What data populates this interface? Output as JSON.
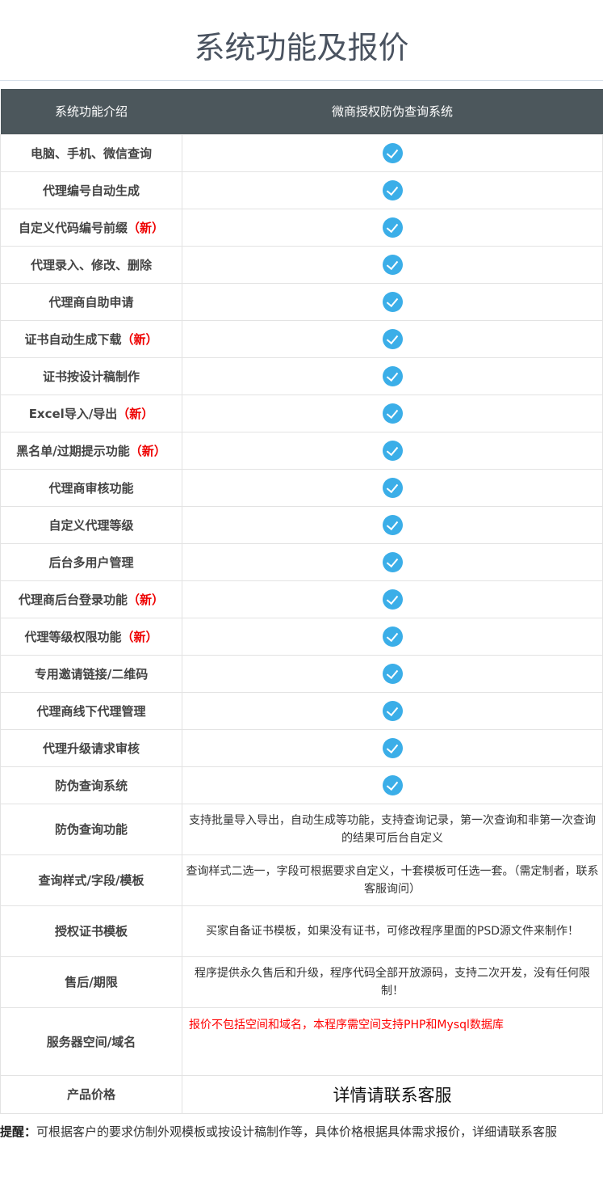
{
  "title": "系统功能及报价",
  "header": {
    "col1": "系统功能介绍",
    "col2": "微商授权防伪查询系统"
  },
  "new_tag": "（新）",
  "features": [
    {
      "label": "电脑、手机、微信查询",
      "new": false
    },
    {
      "label": "代理编号自动生成",
      "new": false
    },
    {
      "label": "自定义代码编号前缀",
      "new": true
    },
    {
      "label": "代理录入、修改、删除",
      "new": false
    },
    {
      "label": "代理商自助申请",
      "new": false
    },
    {
      "label": "证书自动生成下载",
      "new": true
    },
    {
      "label": "证书按设计稿制作",
      "new": false
    },
    {
      "label": "Excel导入/导出",
      "new": true
    },
    {
      "label": "黑名单/过期提示功能",
      "new": true
    },
    {
      "label": "代理商审核功能",
      "new": false
    },
    {
      "label": "自定义代理等级",
      "new": false
    },
    {
      "label": "后台多用户管理",
      "new": false
    },
    {
      "label": "代理商后台登录功能",
      "new": true
    },
    {
      "label": "代理等级权限功能",
      "new": true
    },
    {
      "label": "专用邀请链接/二维码",
      "new": false
    },
    {
      "label": "代理商线下代理管理",
      "new": false
    },
    {
      "label": "代理升级请求审核",
      "new": false
    },
    {
      "label": "防伪查询系统",
      "new": false
    }
  ],
  "details": [
    {
      "label": "防伪查询功能",
      "text": "支持批量导入导出，自动生成等功能，支持查询记录，第一次查询和非第一次查询的结果可后台自定义"
    },
    {
      "label": "查询样式/字段/模板",
      "text": "查询样式二选一，字段可根据要求自定义，十套模板可任选一套。（需定制者，联系客服询问）"
    },
    {
      "label": "授权证书模板",
      "text": "买家自备证书模板，如果没有证书，可修改程序里面的PSD源文件来制作！"
    },
    {
      "label": "售后/期限",
      "text": "程序提供永久售后和升级，程序代码全部开放源码，支持二次开发，没有任何限制！"
    }
  ],
  "server": {
    "label": "服务器空间/域名",
    "text": "报价不包括空间和域名，本程序需空间支持PHP和Mysql数据库"
  },
  "price": {
    "label": "产品价格",
    "text": "详情请联系客服"
  },
  "note": {
    "prefix": "提醒：",
    "text": "可根据客户的要求仿制外观模板或按设计稿制作等，具体价格根据具体需求报价，详细请联系客服"
  }
}
